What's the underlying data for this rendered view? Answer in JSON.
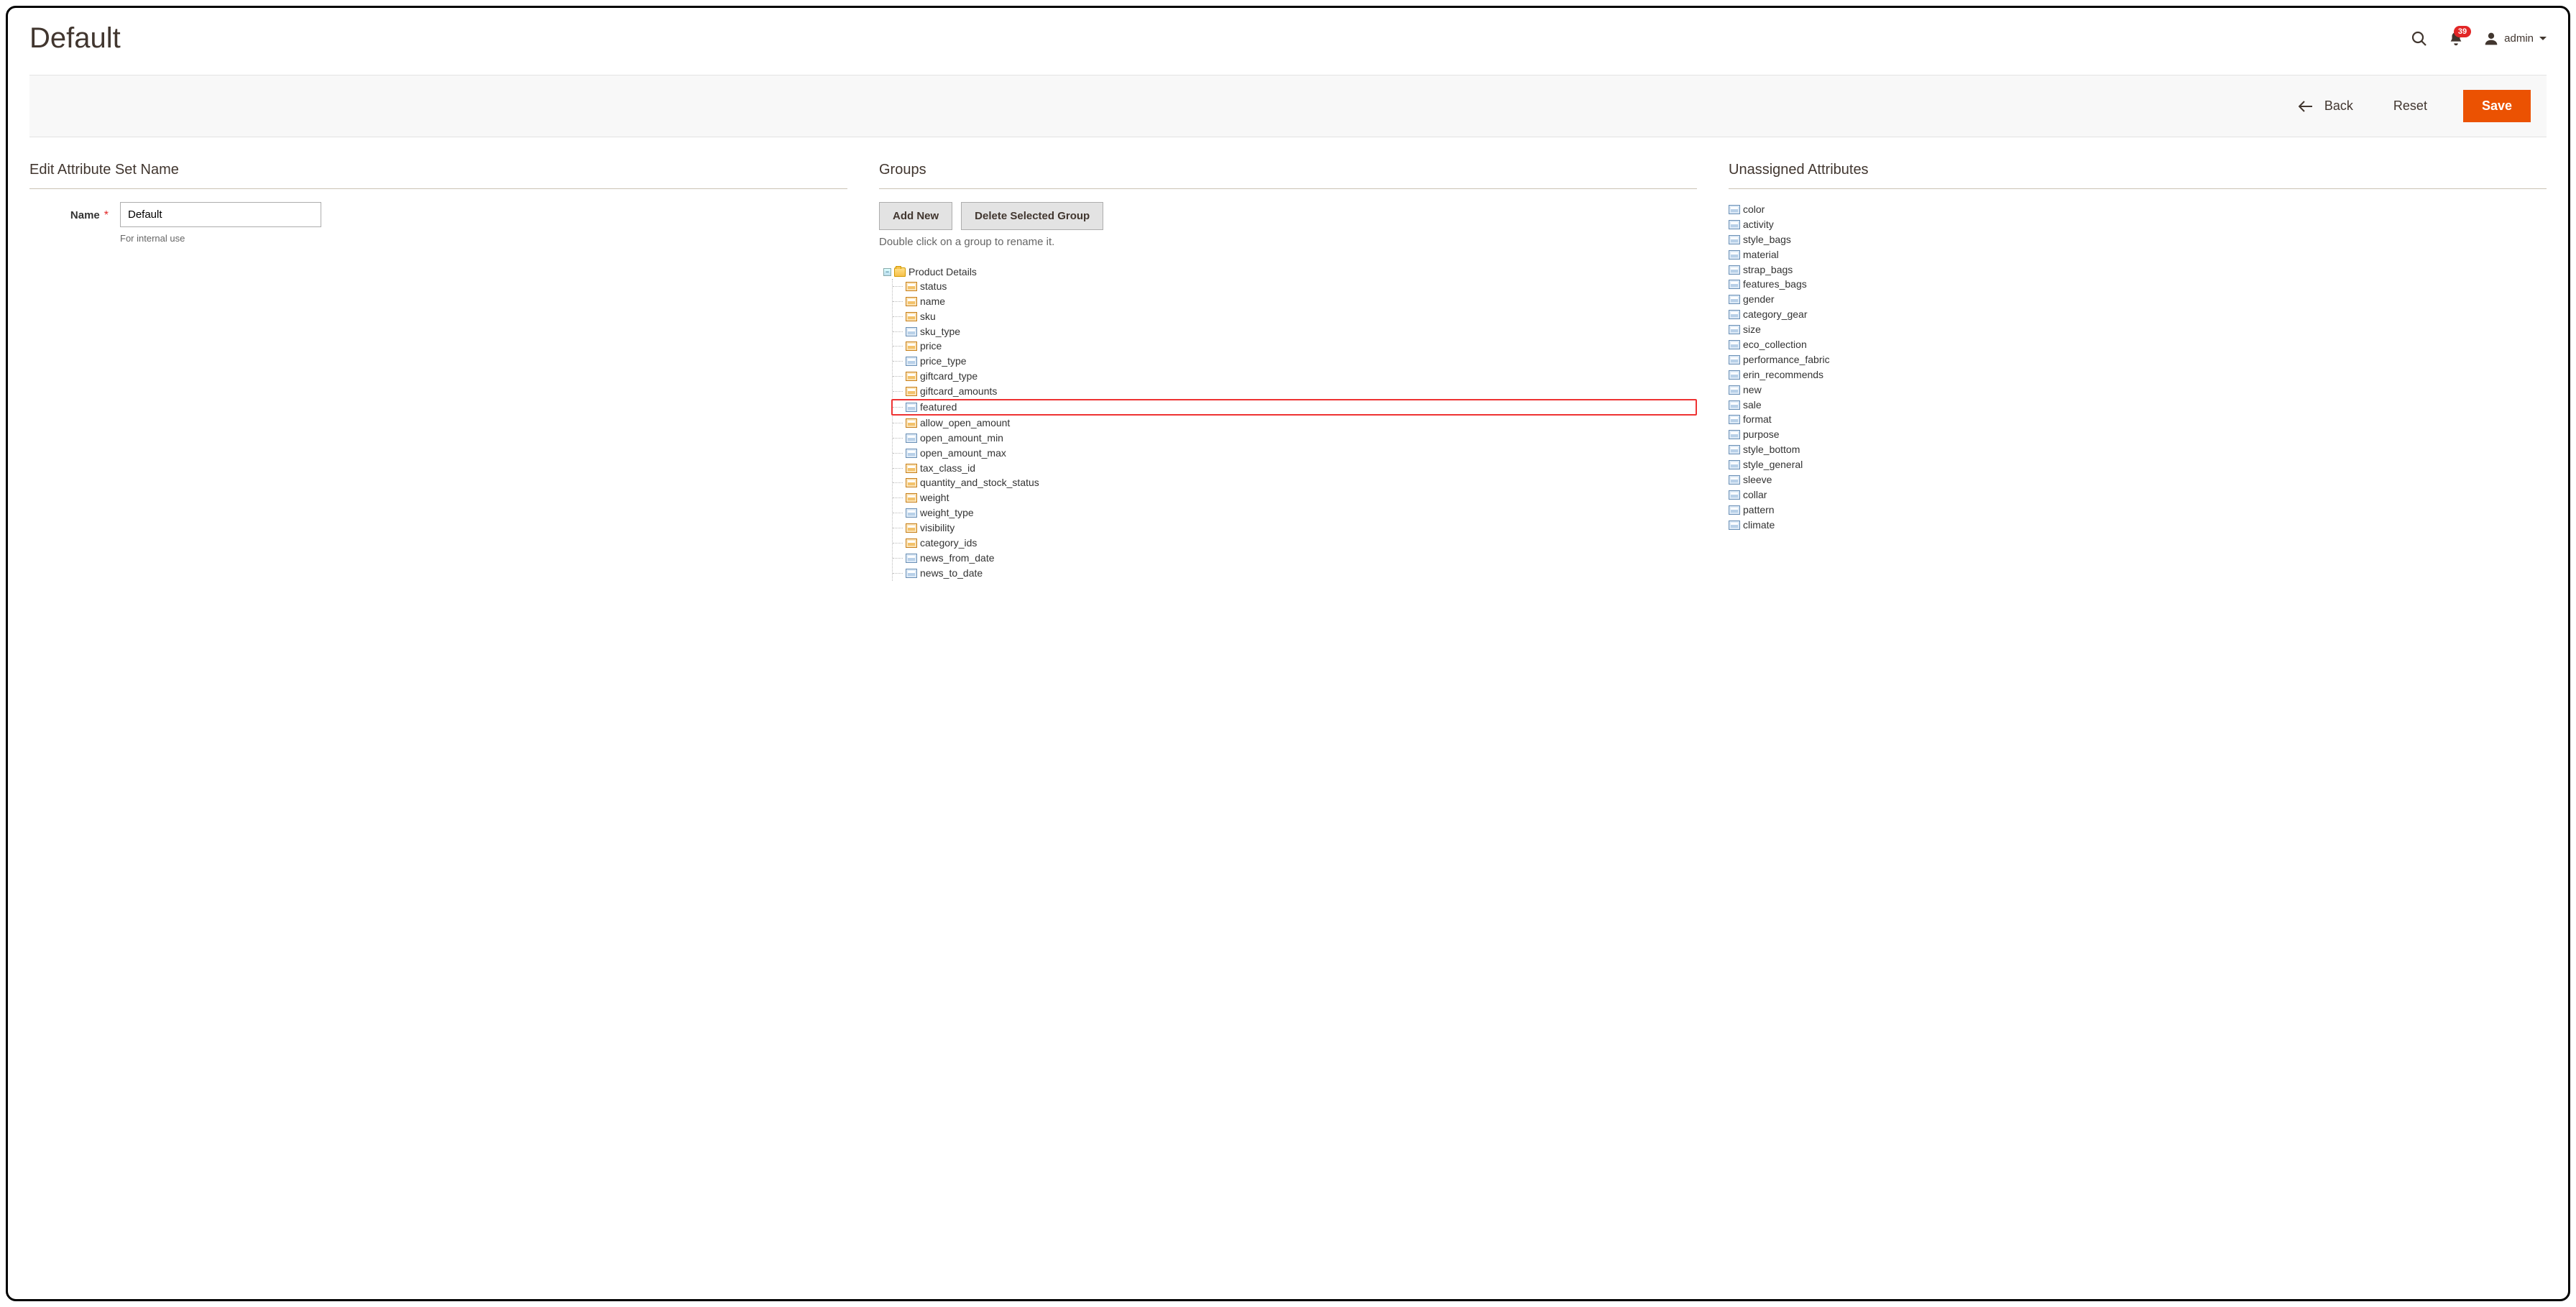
{
  "header": {
    "page_title": "Default",
    "notification_count": "39",
    "user_label": "admin"
  },
  "toolbar": {
    "back_label": "Back",
    "reset_label": "Reset",
    "save_label": "Save"
  },
  "edit_section": {
    "title": "Edit Attribute Set Name",
    "name_label": "Name",
    "name_value": "Default",
    "hint": "For internal use"
  },
  "groups_section": {
    "title": "Groups",
    "add_new_label": "Add New",
    "delete_label": "Delete Selected Group",
    "hint": "Double click on a group to rename it.",
    "root_label": "Product Details",
    "attributes": [
      {
        "label": "status",
        "sys": true
      },
      {
        "label": "name",
        "sys": true
      },
      {
        "label": "sku",
        "sys": true
      },
      {
        "label": "sku_type",
        "sys": false
      },
      {
        "label": "price",
        "sys": true
      },
      {
        "label": "price_type",
        "sys": false
      },
      {
        "label": "giftcard_type",
        "sys": true
      },
      {
        "label": "giftcard_amounts",
        "sys": true
      },
      {
        "label": "featured",
        "sys": false,
        "highlight": true
      },
      {
        "label": "allow_open_amount",
        "sys": true
      },
      {
        "label": "open_amount_min",
        "sys": false
      },
      {
        "label": "open_amount_max",
        "sys": false
      },
      {
        "label": "tax_class_id",
        "sys": true
      },
      {
        "label": "quantity_and_stock_status",
        "sys": true
      },
      {
        "label": "weight",
        "sys": true
      },
      {
        "label": "weight_type",
        "sys": false
      },
      {
        "label": "visibility",
        "sys": true
      },
      {
        "label": "category_ids",
        "sys": true
      },
      {
        "label": "news_from_date",
        "sys": false
      },
      {
        "label": "news_to_date",
        "sys": false
      }
    ]
  },
  "unassigned_section": {
    "title": "Unassigned Attributes",
    "attributes": [
      "color",
      "activity",
      "style_bags",
      "material",
      "strap_bags",
      "features_bags",
      "gender",
      "category_gear",
      "size",
      "eco_collection",
      "performance_fabric",
      "erin_recommends",
      "new",
      "sale",
      "format",
      "purpose",
      "style_bottom",
      "style_general",
      "sleeve",
      "collar",
      "pattern",
      "climate"
    ]
  }
}
